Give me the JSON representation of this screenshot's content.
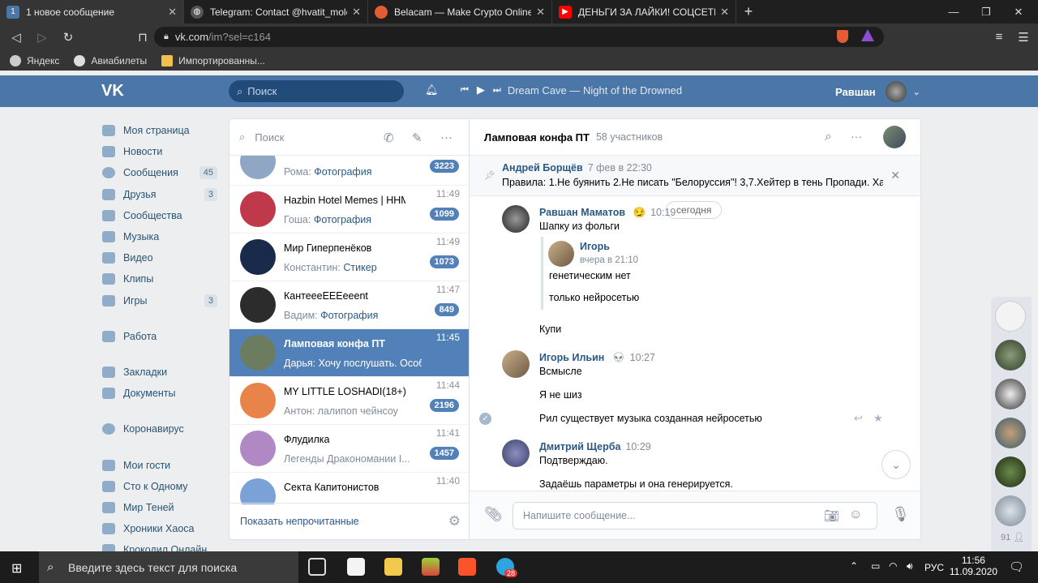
{
  "browser": {
    "tabs": [
      {
        "title": "1 новое сообщение",
        "badge": "1",
        "color": "#4a76a8"
      },
      {
        "title": "Telegram: Contact @hvatit_molcha",
        "badge": "",
        "color": "#555555"
      },
      {
        "title": "Belacam — Make Crypto Online",
        "badge": "",
        "color": "#e25d33"
      },
      {
        "title": "ДЕНЬГИ ЗА ЛАЙКИ! СОЦСЕТЬ ВЕ",
        "badge": "",
        "color": "#ff0000"
      }
    ],
    "url_host": "vk.com",
    "url_path": "/im?sel=c164",
    "bookmarks": [
      "Яндекс",
      "Авиабилеты",
      "Импортированны..."
    ]
  },
  "header": {
    "logo": "VK",
    "search_placeholder": "Поиск",
    "track": "Dream Cave — Night of the Drowned",
    "user_name": "Равшан"
  },
  "menu": {
    "items": [
      {
        "label": "Моя страница",
        "count": ""
      },
      {
        "label": "Новости",
        "count": ""
      },
      {
        "label": "Сообщения",
        "count": "45"
      },
      {
        "label": "Друзья",
        "count": "3"
      },
      {
        "label": "Сообщества",
        "count": ""
      },
      {
        "label": "Музыка",
        "count": ""
      },
      {
        "label": "Видео",
        "count": ""
      },
      {
        "label": "Клипы",
        "count": ""
      },
      {
        "label": "Игры",
        "count": "3"
      }
    ],
    "items2": [
      "Работа"
    ],
    "items3": [
      "Закладки",
      "Документы"
    ],
    "items4": [
      "Коронавирус"
    ],
    "items5": [
      "Мои гости",
      "Сто к Одному",
      "Мир Теней",
      "Хроники Хаоса",
      "Крокодил Онлайн"
    ]
  },
  "dialogs": {
    "search_placeholder": "Поиск",
    "items": [
      {
        "name": "",
        "sender": "Рома:",
        "preview": "Фотография",
        "time": "",
        "unread": "3223",
        "color": "#8fa6c4"
      },
      {
        "name": "Hazbin Hotel Memes | HHM",
        "sender": "Гоша:",
        "preview": "Фотография",
        "time": "11:49",
        "unread": "1099",
        "color": "#c0394a"
      },
      {
        "name": "Мир Гиперпенёков",
        "sender": "Константин:",
        "preview": "Стикер",
        "time": "11:49",
        "unread": "1073",
        "color": "#1a2a4a"
      },
      {
        "name": "КантееeЕЕЕeeent",
        "sender": "Вадим:",
        "preview": "Фотография",
        "time": "11:47",
        "unread": "849",
        "color": "#2c2c2c"
      },
      {
        "name": "Ламповая конфа ПТ",
        "sender": "Дарья:",
        "preview": "Хочу послушать. Особенно ес...",
        "time": "11:45",
        "unread": "",
        "color": "#6b7c5f"
      },
      {
        "name": "MY LITTLE LOSHADI(18+):...",
        "sender": "Антон:",
        "preview": "лалипоп чейнсоу",
        "time": "11:44",
        "unread": "2196",
        "color": "#e8844a"
      },
      {
        "name": "Флудилка",
        "sender": "",
        "preview": "Легенды Дракономании I...",
        "time": "11:41",
        "unread": "1457",
        "color": "#b089c4"
      },
      {
        "name": "Секта Капитонистов",
        "sender": "",
        "preview": "",
        "time": "11:40",
        "unread": "",
        "color": "#7aa2d6"
      }
    ],
    "footer": "Показать непрочитанные"
  },
  "chat": {
    "title": "Ламповая конфа ПТ",
    "members": "58 участников",
    "pinned": {
      "author": "Андрей Борщёв",
      "time": "7 фев в 22:30",
      "text": "Правила: 1.Не буянить 2.Не писать \"Белоруссия\"! 3,7.Хейтер в тень Пропади. Ха..."
    },
    "date_pill": "сегодня",
    "messages": [
      {
        "author": "Равшан Маматов",
        "time": "10:19",
        "text": "Шапку из фольги"
      },
      {
        "quote_author": "Игорь",
        "quote_time": "вчера в 21:10",
        "quote_lines": [
          "генетическим нет",
          "только нейросетью"
        ]
      },
      {
        "text": "Купи"
      },
      {
        "author": "Игорь Ильин",
        "time": "10:27",
        "text": "Всмысле"
      },
      {
        "text": "Я не шиз"
      },
      {
        "text": "Рил существует музыка созданная нейросетью"
      },
      {
        "author": "Дмитрий Щерба",
        "time": "10:29",
        "text": "Подтверждаю."
      },
      {
        "text": "Задаёшь параметры и она генерируется."
      }
    ],
    "compose_placeholder": "Напишите сообщение..."
  },
  "rail": {
    "online_count": "91"
  },
  "taskbar": {
    "search_placeholder": "Введите здесь текст для поиска",
    "lang": "РУС",
    "time": "11:56",
    "date": "11.09.2020",
    "telegram_badge": "28"
  }
}
